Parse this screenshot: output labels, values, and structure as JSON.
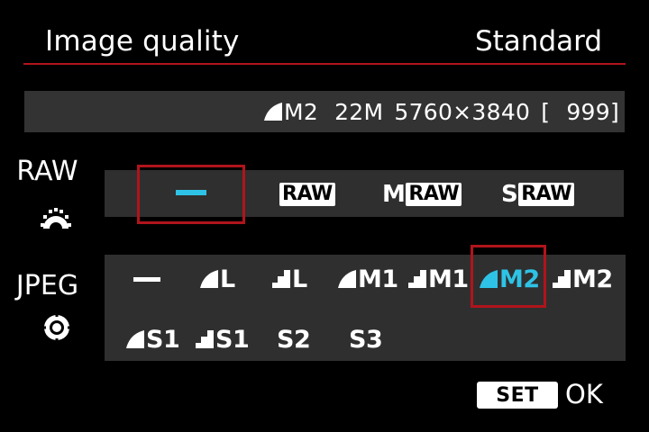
{
  "header": {
    "title": "Image quality",
    "mode": "Standard"
  },
  "info": {
    "quality": "M2",
    "megapixels": "22M",
    "resolution": "5760×3840",
    "shots_open": "[",
    "shots": "999]"
  },
  "raw": {
    "label": "RAW",
    "options": [
      {
        "id": "none",
        "label": "",
        "selected": true
      },
      {
        "id": "raw",
        "label": "RAW"
      },
      {
        "id": "mraw",
        "prefix": "M",
        "label": "RAW"
      },
      {
        "id": "sraw",
        "prefix": "S",
        "label": "RAW"
      }
    ]
  },
  "jpeg": {
    "label": "JPEG",
    "options": [
      {
        "id": "none",
        "label": ""
      },
      {
        "id": "l-fine",
        "label": "L"
      },
      {
        "id": "l-normal",
        "label": "L"
      },
      {
        "id": "m1-fine",
        "label": "M1"
      },
      {
        "id": "m1-normal",
        "label": "M1"
      },
      {
        "id": "m2-fine",
        "label": "M2",
        "selected": true
      },
      {
        "id": "m2-normal",
        "label": "M2"
      },
      {
        "id": "s1-fine",
        "label": "S1"
      },
      {
        "id": "s1-normal",
        "label": "S1"
      },
      {
        "id": "s2",
        "label": "S2"
      },
      {
        "id": "s3",
        "label": "S3"
      }
    ]
  },
  "footer": {
    "set_label": "SET",
    "ok_label": "OK"
  },
  "colors": {
    "accent_red": "#b0141c",
    "selected_cyan": "#2ec3e6",
    "row_bg": "#2f2f2f"
  }
}
